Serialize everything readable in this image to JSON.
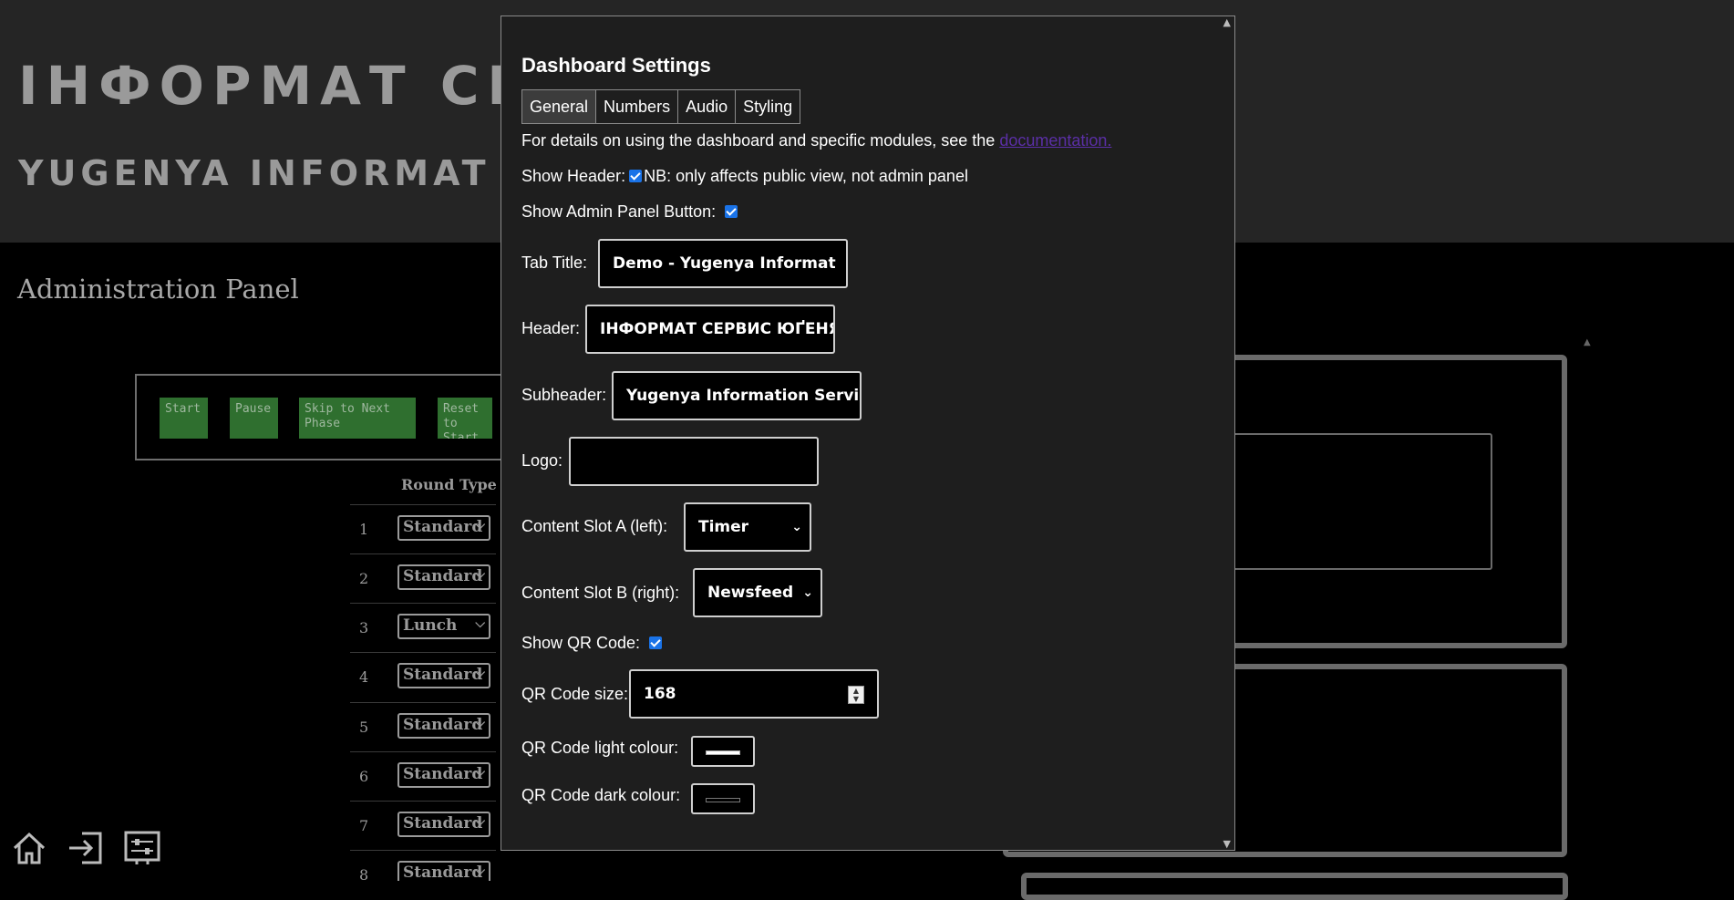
{
  "background": {
    "header_title": "ІНФОРМАТ СЕ",
    "header_subtitle": "YUGENYA INFORMAT",
    "admin_panel_title": "Administration Panel",
    "controls": [
      {
        "label": "Start"
      },
      {
        "label": "Pause"
      },
      {
        "label": "Skip to Next Phase"
      },
      {
        "label": "Reset to Start"
      }
    ],
    "round_type_header": "Round Type",
    "rounds": [
      {
        "num": "1",
        "type": "Standard"
      },
      {
        "num": "2",
        "type": "Standard"
      },
      {
        "num": "3",
        "type": "Lunch"
      },
      {
        "num": "4",
        "type": "Standard"
      },
      {
        "num": "5",
        "type": "Standard"
      },
      {
        "num": "6",
        "type": "Standard"
      },
      {
        "num": "7",
        "type": "Standard"
      },
      {
        "num": "8",
        "type": "Standard"
      }
    ],
    "bottom_icons": [
      "home-icon",
      "sign-in-icon",
      "settings-sliders-icon"
    ]
  },
  "modal": {
    "title": "Dashboard Settings",
    "tabs": [
      {
        "label": "General",
        "active": true
      },
      {
        "label": "Numbers",
        "active": false
      },
      {
        "label": "Audio",
        "active": false
      },
      {
        "label": "Styling",
        "active": false
      }
    ],
    "details_text": "For details on using the dashboard and specific modules, see the",
    "details_link": "documentation.",
    "show_header_label": "Show Header:",
    "show_header_checked": true,
    "show_header_note": "NB: only affects public view, not admin panel",
    "show_admin_button_label": "Show Admin Panel Button:",
    "show_admin_button_checked": true,
    "tab_title_label": "Tab Title:",
    "tab_title_value": "Demo - Yugenya Informat",
    "header_label": "Header:",
    "header_value": "ІНФОРМАТ СЕРВИС ЮҐЕНЯ",
    "subheader_label": "Subheader:",
    "subheader_value": "Yugenya Information Servi",
    "logo_label": "Logo:",
    "logo_value": "",
    "slot_a_label": "Content Slot A (left):",
    "slot_a_value": "Timer",
    "slot_b_label": "Content Slot B (right):",
    "slot_b_value": "Newsfeed",
    "show_qr_label": "Show QR Code:",
    "show_qr_checked": true,
    "qr_size_label": "QR Code size:",
    "qr_size_value": "168",
    "qr_light_label": "QR Code light colour:",
    "qr_light_color": "#ffffff",
    "qr_dark_label": "QR Code dark colour:",
    "qr_dark_color": "#000000"
  },
  "colors": {
    "control_button": "#2f6f2f",
    "checkbox_accent": "#1a73e8",
    "link": "#5b2fa6"
  }
}
